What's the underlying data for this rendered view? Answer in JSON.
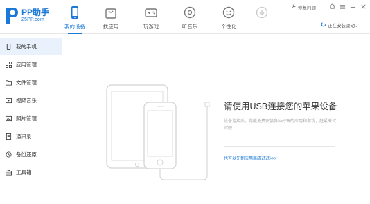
{
  "brand": {
    "title": "PP助手",
    "subtitle": "25PP.com",
    "accent": "#1a78d9"
  },
  "nav": [
    {
      "label": "我的设备",
      "icon": "phone-icon",
      "active": true
    },
    {
      "label": "找应用",
      "icon": "bag-icon",
      "active": false
    },
    {
      "label": "玩游戏",
      "icon": "gamepad-icon",
      "active": false
    },
    {
      "label": "听音乐",
      "icon": "music-disc-icon",
      "active": false
    },
    {
      "label": "个性化",
      "icon": "smiley-icon",
      "active": false
    },
    {
      "label": "",
      "icon": "download-icon",
      "active": false
    }
  ],
  "header": {
    "feedback": "修复问题",
    "status": "正在安装驱动..."
  },
  "sidebar": {
    "items": [
      {
        "label": "我的手机",
        "icon": "phone-icon",
        "active": true
      },
      {
        "label": "应用管理",
        "icon": "apps-grid-icon",
        "active": false
      },
      {
        "label": "文件管理",
        "icon": "folder-icon",
        "active": false
      },
      {
        "label": "视频音乐",
        "icon": "video-icon",
        "active": false
      },
      {
        "label": "照片管理",
        "icon": "photo-icon",
        "active": false
      },
      {
        "label": "通讯录",
        "icon": "contacts-icon",
        "active": false
      },
      {
        "label": "备份还原",
        "icon": "backup-icon",
        "active": false
      },
      {
        "label": "工具箱",
        "icon": "toolbox-icon",
        "active": false
      }
    ]
  },
  "main": {
    "title": "请使用USB连接您的苹果设备",
    "description": "设备连接后，你能免费安装各种好玩的应用和游戏，赶紧来试试吧",
    "link": "也可以先到应用商店逛逛>>>"
  }
}
